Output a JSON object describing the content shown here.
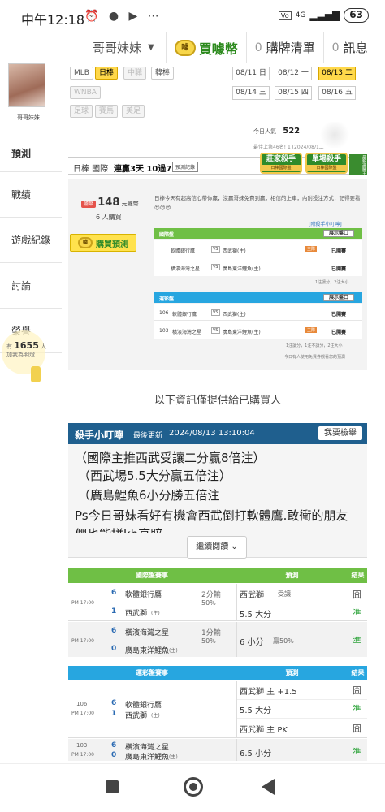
{
  "status": {
    "time": "中午12:18",
    "icons": "⏰ ● ▶ ⋯",
    "battery": "63",
    "net": "4G"
  },
  "topnav": {
    "user": "哥哥妹妹",
    "buy_coin": "買噱幣",
    "cart_count": "0",
    "cart_label": "購牌清單",
    "msg_count": "0",
    "msg_label": "訊息",
    "coin_icon_text": "噱"
  },
  "profile": {
    "avatar_name": "哥哥妹妹"
  },
  "sidebar": {
    "items": [
      "預測",
      "戰績",
      "遊戲紀錄",
      "討論",
      "榮譽"
    ],
    "fans_prefix": "有",
    "fans_count": "1655",
    "fans_suffix": "人",
    "fans_note": "加我為明燈"
  },
  "leagues": {
    "row1": [
      "MLB",
      "日棒",
      "中職",
      "韓棒"
    ],
    "row2": [
      "WNBA"
    ],
    "row3": [
      "足球",
      "賽馬",
      "美足"
    ]
  },
  "dates": [
    "08/11 日",
    "08/12 一",
    "08/13 二",
    "08/14 三",
    "08/15 四",
    "08/16 五"
  ],
  "popularity": {
    "label": "今日人氣",
    "value": "522",
    "rank": "最佳上第46名! 1 (2024/08/13)"
  },
  "header": {
    "league": "日棒 國際",
    "streak": "連贏3天 10過7",
    "record_btn": "預測記錄",
    "badge1_title": "莊家殺手",
    "badge1_sub": "日棒國際盤",
    "badge2_title": "單場殺手",
    "badge2_sub": "日棒國際盤",
    "corner": "最新連勝王"
  },
  "price": {
    "tag": "噱幣",
    "amount": "148",
    "unit": "元噱幣",
    "buyers": "6",
    "buyers_unit": "人購買",
    "buy_btn": "購買預測",
    "description": "日棒今天有超高信心帶你贏，沒贏哥妹免費到贏，相信的上車，內附投注方式，記得要看😍😍😍"
  },
  "intl_panel": {
    "link": "[附殺手小叮嚀]",
    "title": "國際盤",
    "btn": "展示盤口",
    "rows": [
      {
        "team1": "軟體銀行鷹",
        "team2": "西武獅(主)",
        "flag": "主隊",
        "status": "已開賽"
      },
      {
        "team1": "橫濱海灣之星",
        "team2": "廣島東洋鯉魚(主)",
        "flag": "",
        "status": "已開賽"
      }
    ],
    "note": "1注讓分，2注大小"
  },
  "ou_panel": {
    "title": "運彩盤",
    "btn": "展示盤口",
    "rows": [
      {
        "num": "106",
        "team1": "軟體銀行鷹",
        "team2": "西武獅(主)",
        "flag": "",
        "status": "已開賽"
      },
      {
        "num": "103",
        "team1": "橫濱海灣之星",
        "team2": "廣島東洋鯉魚(主)",
        "flag": "主隊",
        "status": "已開賽"
      }
    ],
    "note": "1注讓分，1注不讓分，2注大小",
    "note2": "今日有人使用免費券觀看您的預測"
  },
  "info_only": "以下資訊僅提供給已購買人",
  "tips": {
    "title": "殺手小叮嚀",
    "updated_label": "最後更新",
    "updated": "2024/08/13 13:10:04",
    "report_btn": "我要檢舉",
    "lines": [
      "（國際主推西武受讓二分贏8倍注）",
      "（西武場5.5大分贏五倍注）",
      "（廣島鯉魚6小分勝五倍注",
      "Ps今日哥妹看好有機會西武倒打軟體鷹.敢衝的朋友",
      "們也能拼kb高賠"
    ],
    "continue": "繼續閱讀"
  },
  "table1": {
    "h1": "國際盤賽事",
    "h2": "預測",
    "h3": "結果",
    "games": [
      {
        "time": "PM 17:00",
        "s1": "6",
        "t1": "軟體銀行鷹",
        "s2": "1",
        "t2": "西武獅",
        "t2_mark": "(主)",
        "line": "2分輸",
        "pct": "50%",
        "pick1": "西武獅",
        "pick1_extra": "受讓",
        "pick2": "5.5 大分",
        "r1": "囧",
        "r2": "準"
      },
      {
        "time": "PM 17:00",
        "s1": "6",
        "t1": "橫濱海灣之星",
        "s2": "0",
        "t2": "廣島東洋鯉魚",
        "t2_mark": "(主)",
        "line": "1分輸",
        "pct": "50%",
        "pick1": "6 小分",
        "pick1_extra": "贏50%",
        "r1": "準"
      }
    ]
  },
  "table2": {
    "h1": "運彩盤賽事",
    "h2": "預測",
    "h3": "結果",
    "games": [
      {
        "num": "106",
        "time": "PM 17:00",
        "s1": "6",
        "t1": "軟體銀行鷹",
        "s2": "1",
        "t2": "西武獅",
        "t2_mark": "(主)",
        "picks": [
          "西武獅 主 +1.5",
          "5.5 大分",
          "西武獅 主 PK"
        ],
        "results": [
          "囧",
          "準",
          "囧"
        ]
      },
      {
        "num": "103",
        "time": "PM 17:00",
        "s1": "6",
        "t1": "橫濱海灣之星",
        "s2": "0",
        "t2": "廣島東洋鯉魚",
        "t2_mark": "(主)",
        "picks": [
          "6.5 小分"
        ],
        "results": [
          "準"
        ]
      }
    ]
  },
  "colors": {
    "green": "#6fbf45",
    "blue": "#27a6e0",
    "yellow": "#ffd84a",
    "tips_header": "#1f5f8e"
  }
}
